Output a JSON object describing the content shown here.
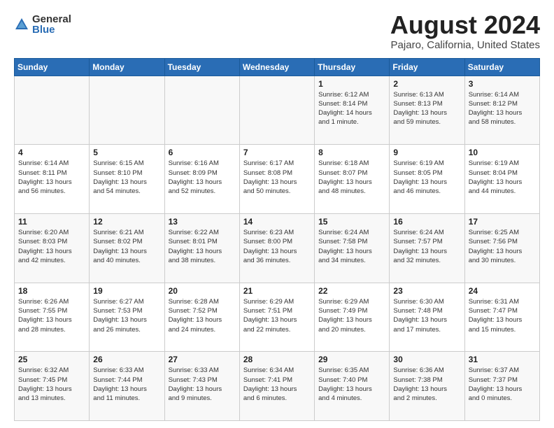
{
  "logo": {
    "general": "General",
    "blue": "Blue"
  },
  "title": "August 2024",
  "subtitle": "Pajaro, California, United States",
  "days_of_week": [
    "Sunday",
    "Monday",
    "Tuesday",
    "Wednesday",
    "Thursday",
    "Friday",
    "Saturday"
  ],
  "weeks": [
    [
      {
        "day": "",
        "text": ""
      },
      {
        "day": "",
        "text": ""
      },
      {
        "day": "",
        "text": ""
      },
      {
        "day": "",
        "text": ""
      },
      {
        "day": "1",
        "text": "Sunrise: 6:12 AM\nSunset: 8:14 PM\nDaylight: 14 hours\nand 1 minute."
      },
      {
        "day": "2",
        "text": "Sunrise: 6:13 AM\nSunset: 8:13 PM\nDaylight: 13 hours\nand 59 minutes."
      },
      {
        "day": "3",
        "text": "Sunrise: 6:14 AM\nSunset: 8:12 PM\nDaylight: 13 hours\nand 58 minutes."
      }
    ],
    [
      {
        "day": "4",
        "text": "Sunrise: 6:14 AM\nSunset: 8:11 PM\nDaylight: 13 hours\nand 56 minutes."
      },
      {
        "day": "5",
        "text": "Sunrise: 6:15 AM\nSunset: 8:10 PM\nDaylight: 13 hours\nand 54 minutes."
      },
      {
        "day": "6",
        "text": "Sunrise: 6:16 AM\nSunset: 8:09 PM\nDaylight: 13 hours\nand 52 minutes."
      },
      {
        "day": "7",
        "text": "Sunrise: 6:17 AM\nSunset: 8:08 PM\nDaylight: 13 hours\nand 50 minutes."
      },
      {
        "day": "8",
        "text": "Sunrise: 6:18 AM\nSunset: 8:07 PM\nDaylight: 13 hours\nand 48 minutes."
      },
      {
        "day": "9",
        "text": "Sunrise: 6:19 AM\nSunset: 8:05 PM\nDaylight: 13 hours\nand 46 minutes."
      },
      {
        "day": "10",
        "text": "Sunrise: 6:19 AM\nSunset: 8:04 PM\nDaylight: 13 hours\nand 44 minutes."
      }
    ],
    [
      {
        "day": "11",
        "text": "Sunrise: 6:20 AM\nSunset: 8:03 PM\nDaylight: 13 hours\nand 42 minutes."
      },
      {
        "day": "12",
        "text": "Sunrise: 6:21 AM\nSunset: 8:02 PM\nDaylight: 13 hours\nand 40 minutes."
      },
      {
        "day": "13",
        "text": "Sunrise: 6:22 AM\nSunset: 8:01 PM\nDaylight: 13 hours\nand 38 minutes."
      },
      {
        "day": "14",
        "text": "Sunrise: 6:23 AM\nSunset: 8:00 PM\nDaylight: 13 hours\nand 36 minutes."
      },
      {
        "day": "15",
        "text": "Sunrise: 6:24 AM\nSunset: 7:58 PM\nDaylight: 13 hours\nand 34 minutes."
      },
      {
        "day": "16",
        "text": "Sunrise: 6:24 AM\nSunset: 7:57 PM\nDaylight: 13 hours\nand 32 minutes."
      },
      {
        "day": "17",
        "text": "Sunrise: 6:25 AM\nSunset: 7:56 PM\nDaylight: 13 hours\nand 30 minutes."
      }
    ],
    [
      {
        "day": "18",
        "text": "Sunrise: 6:26 AM\nSunset: 7:55 PM\nDaylight: 13 hours\nand 28 minutes."
      },
      {
        "day": "19",
        "text": "Sunrise: 6:27 AM\nSunset: 7:53 PM\nDaylight: 13 hours\nand 26 minutes."
      },
      {
        "day": "20",
        "text": "Sunrise: 6:28 AM\nSunset: 7:52 PM\nDaylight: 13 hours\nand 24 minutes."
      },
      {
        "day": "21",
        "text": "Sunrise: 6:29 AM\nSunset: 7:51 PM\nDaylight: 13 hours\nand 22 minutes."
      },
      {
        "day": "22",
        "text": "Sunrise: 6:29 AM\nSunset: 7:49 PM\nDaylight: 13 hours\nand 20 minutes."
      },
      {
        "day": "23",
        "text": "Sunrise: 6:30 AM\nSunset: 7:48 PM\nDaylight: 13 hours\nand 17 minutes."
      },
      {
        "day": "24",
        "text": "Sunrise: 6:31 AM\nSunset: 7:47 PM\nDaylight: 13 hours\nand 15 minutes."
      }
    ],
    [
      {
        "day": "25",
        "text": "Sunrise: 6:32 AM\nSunset: 7:45 PM\nDaylight: 13 hours\nand 13 minutes."
      },
      {
        "day": "26",
        "text": "Sunrise: 6:33 AM\nSunset: 7:44 PM\nDaylight: 13 hours\nand 11 minutes."
      },
      {
        "day": "27",
        "text": "Sunrise: 6:33 AM\nSunset: 7:43 PM\nDaylight: 13 hours\nand 9 minutes."
      },
      {
        "day": "28",
        "text": "Sunrise: 6:34 AM\nSunset: 7:41 PM\nDaylight: 13 hours\nand 6 minutes."
      },
      {
        "day": "29",
        "text": "Sunrise: 6:35 AM\nSunset: 7:40 PM\nDaylight: 13 hours\nand 4 minutes."
      },
      {
        "day": "30",
        "text": "Sunrise: 6:36 AM\nSunset: 7:38 PM\nDaylight: 13 hours\nand 2 minutes."
      },
      {
        "day": "31",
        "text": "Sunrise: 6:37 AM\nSunset: 7:37 PM\nDaylight: 13 hours\nand 0 minutes."
      }
    ]
  ]
}
